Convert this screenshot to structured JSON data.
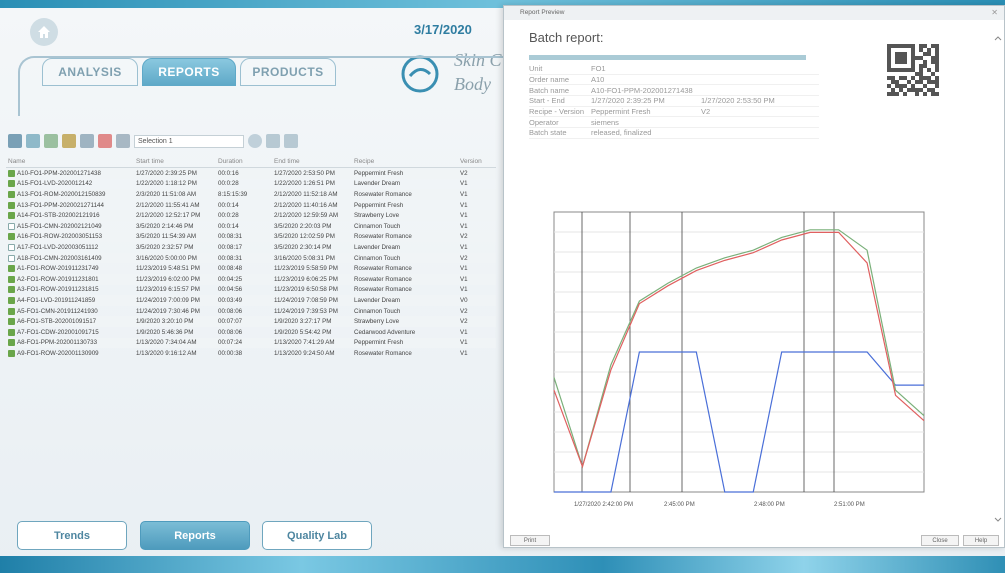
{
  "header": {
    "date": "3/17/2020",
    "logo_line1": "Skin C",
    "logo_line2": "Body"
  },
  "tabs": [
    {
      "label": "ANALYSIS"
    },
    {
      "label": "REPORTS"
    },
    {
      "label": "PRODUCTS"
    }
  ],
  "toolbar": {
    "select_value": "Selection 1"
  },
  "table": {
    "headers": [
      "Name",
      "Start time",
      "Duration",
      "End time",
      "Recipe",
      "Version"
    ],
    "rows": [
      [
        "A10-FO1-PPM-202001271438",
        "1/27/2020 2:39:25 PM",
        "00:0:16",
        "1/27/2020 2:53:50 PM",
        "Peppermint Fresh",
        "V2"
      ],
      [
        "A15-FO1-LVD-2020012142",
        "1/22/2020 1:18:12 PM",
        "00:0:28",
        "1/22/2020 1:26:51 PM",
        "Lavender Dream",
        "V1"
      ],
      [
        "A13-FO1-ROM-2020012150839",
        "2/3/2020 11:51:08 AM",
        "8:15:15:39",
        "2/12/2020 11:52:18 AM",
        "Rosewater Romance",
        "V1"
      ],
      [
        "A13-FO1-PPM-2020021271144",
        "2/12/2020 11:55:41 AM",
        "00:0:14",
        "2/12/2020 11:40:16 AM",
        "Peppermint Fresh",
        "V1"
      ],
      [
        "A14-FO1-STB-202002121916",
        "2/12/2020 12:52:17 PM",
        "00:0:28",
        "2/12/2020 12:59:59 AM",
        "Strawberry Love",
        "V1"
      ],
      [
        "A15-FO1-CMN-202002121049",
        "3/5/2020 2:14:46 PM",
        "00:0:14",
        "3/5/2020 2:20:03 PM",
        "Cinnamon Touch",
        "V1"
      ],
      [
        "A16-FO1-ROW-202003051153",
        "3/5/2020 11:54:39 AM",
        "00:08:31",
        "3/5/2020 12:02:59 PM",
        "Rosewater Romance",
        "V2"
      ],
      [
        "A17-FO1-LVD-202003051112",
        "3/5/2020 2:32:57 PM",
        "00:08:17",
        "3/5/2020 2:30:14 PM",
        "Lavender Dream",
        "V1"
      ],
      [
        "A18-FO1-CMN-202003161409",
        "3/16/2020 5:00:00 PM",
        "00:08:31",
        "3/16/2020 5:08:31 PM",
        "Cinnamon Touch",
        "V2"
      ],
      [
        "A1-FO1-ROW-201911231749",
        "11/23/2019 5:48:51 PM",
        "00:08:48",
        "11/23/2019 5:58:59 PM",
        "Rosewater Romance",
        "V1"
      ],
      [
        "A2-FO1-ROW-201911231801",
        "11/23/2019 6:02:00 PM",
        "00:04:25",
        "11/23/2019 6:06:25 PM",
        "Rosewater Romance",
        "V1"
      ],
      [
        "A3-FO1-ROW-201911231815",
        "11/23/2019 6:15:57 PM",
        "00:04:56",
        "11/23/2019 6:50:58 PM",
        "Rosewater Romance",
        "V1"
      ],
      [
        "A4-FO1-LVD-201911241859",
        "11/24/2019 7:00:09 PM",
        "00:03:49",
        "11/24/2019 7:08:59 PM",
        "Lavender Dream",
        "V0"
      ],
      [
        "A5-FO1-CMN-201911241930",
        "11/24/2019 7:30:46 PM",
        "00:08:06",
        "11/24/2019 7:39:53 PM",
        "Cinnamon Touch",
        "V2"
      ],
      [
        "A6-FO1-STB-202001091517",
        "1/9/2020 3:20:10 PM",
        "00:07:07",
        "1/9/2020 3:27:17 PM",
        "Strawberry Love",
        "V2"
      ],
      [
        "A7-FO1-CDW-202001091715",
        "1/9/2020 5:46:36 PM",
        "00:08:06",
        "1/9/2020 5:54:42 PM",
        "Cedarwood Adventure",
        "V1"
      ],
      [
        "A8-FO1-PPM-202001130733",
        "1/13/2020 7:34:04 AM",
        "00:07:24",
        "1/13/2020 7:41:29 AM",
        "Peppermint Fresh",
        "V1"
      ],
      [
        "A9-FO1-ROW-202001130909",
        "1/13/2020 9:16:12 AM",
        "00:00:38",
        "1/13/2020 9:24:50 AM",
        "Rosewater Romance",
        "V1"
      ]
    ]
  },
  "bottom_buttons": [
    {
      "label": "Trends"
    },
    {
      "label": "Reports"
    },
    {
      "label": "Quality Lab"
    }
  ],
  "preview": {
    "window_title": "Report Preview",
    "heading": "Batch report:",
    "info": [
      {
        "key": "Unit",
        "value": "FO1",
        "value2": ""
      },
      {
        "key": "Order name",
        "value": "A10",
        "value2": ""
      },
      {
        "key": "Batch name",
        "value": "A10-FO1-PPM-202001271438",
        "value2": ""
      },
      {
        "key": "Start - End",
        "value": "1/27/2020 2:39:25 PM",
        "value2": "1/27/2020 2:53:50 PM"
      },
      {
        "key": "Recipe - Version",
        "value": "Peppermint Fresh",
        "value2": "V2"
      },
      {
        "key": "Operator",
        "value": "siemens",
        "value2": ""
      },
      {
        "key": "Batch state",
        "value": "released, finalized",
        "value2": ""
      }
    ],
    "print_label": "Print",
    "close_label": "Close",
    "help_label": "Help"
  },
  "chart_data": {
    "type": "line",
    "x_tick_labels": [
      "1/27/2020 2:42:00 PM",
      "2:45:00 PM",
      "2:48:00 PM",
      "2:51:00 PM"
    ],
    "series": [
      {
        "color": "#4a6fd8",
        "values": [
          0,
          0,
          0,
          55,
          55,
          55,
          0,
          0,
          55,
          55,
          55,
          55,
          42,
          42
        ]
      },
      {
        "color": "#7ab07a",
        "values": [
          45,
          10,
          50,
          75,
          82,
          88,
          92,
          95,
          100,
          103,
          103,
          95,
          40,
          30
        ]
      },
      {
        "color": "#e06060",
        "values": [
          40,
          10,
          48,
          74,
          81,
          87,
          91,
          94,
          99,
          102,
          102,
          90,
          38,
          28
        ]
      }
    ],
    "colors": {
      "accent": "#2f7da1",
      "active_tab": "#5fa9c8"
    }
  }
}
